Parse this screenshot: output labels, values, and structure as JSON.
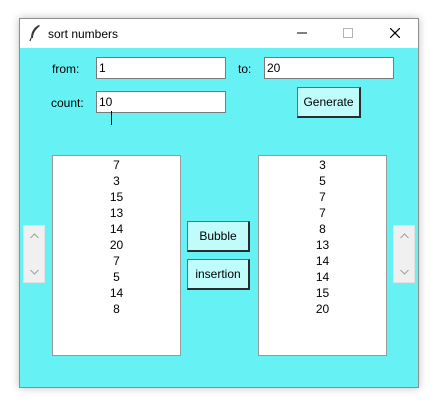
{
  "window": {
    "title": "sort numbers",
    "background": "#66f2f5"
  },
  "form": {
    "from_label": "from:",
    "from_value": "1",
    "to_label": "to:",
    "to_value": "20",
    "count_label": "count:",
    "count_value": "10",
    "generate_label": "Generate"
  },
  "actions": {
    "bubble_label": "Bubble",
    "insertion_label": "insertion"
  },
  "unsorted_list": [
    "7",
    "3",
    "15",
    "13",
    "14",
    "20",
    "7",
    "5",
    "14",
    "8"
  ],
  "sorted_list": [
    "3",
    "5",
    "7",
    "7",
    "8",
    "13",
    "14",
    "14",
    "15",
    "20"
  ]
}
